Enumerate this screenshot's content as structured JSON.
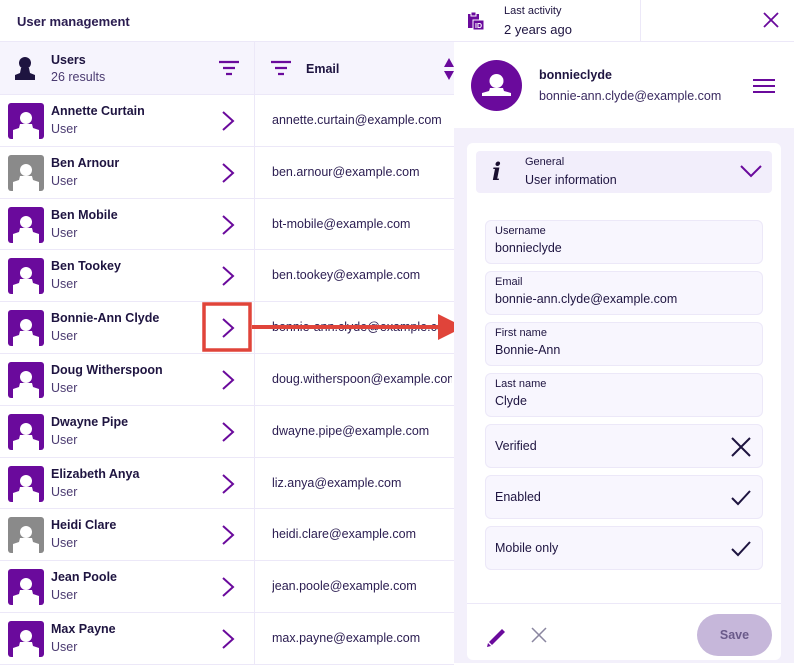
{
  "header": {
    "title": "User management",
    "last_activity_label": "Last activity",
    "last_activity_value": "2 years ago"
  },
  "list": {
    "title": "Users",
    "count": "26 results",
    "email_header": "Email",
    "rows": [
      {
        "name": "Annette Curtain",
        "role": "User",
        "email": "annette.curtain@example.com",
        "avatar": "purple"
      },
      {
        "name": "Ben Arnour",
        "role": "User",
        "email": "ben.arnour@example.com",
        "avatar": "gray"
      },
      {
        "name": "Ben Mobile",
        "role": "User",
        "email": "bt-mobile@example.com",
        "avatar": "purple"
      },
      {
        "name": "Ben Tookey",
        "role": "User",
        "email": "ben.tookey@example.com",
        "avatar": "purple"
      },
      {
        "name": "Bonnie-Ann Clyde",
        "role": "User",
        "email": "bonnie-ann.clyde@example.com",
        "avatar": "purple"
      },
      {
        "name": "Doug Witherspoon",
        "role": "User",
        "email": "doug.witherspoon@example.com",
        "avatar": "purple"
      },
      {
        "name": "Dwayne Pipe",
        "role": "User",
        "email": "dwayne.pipe@example.com",
        "avatar": "purple"
      },
      {
        "name": "Elizabeth Anya",
        "role": "User",
        "email": "liz.anya@example.com",
        "avatar": "purple"
      },
      {
        "name": "Heidi Clare",
        "role": "User",
        "email": "heidi.clare@example.com",
        "avatar": "gray"
      },
      {
        "name": "Jean Poole",
        "role": "User",
        "email": "jean.poole@example.com",
        "avatar": "purple"
      },
      {
        "name": "Max Payne",
        "role": "User",
        "email": "max.payne@example.com",
        "avatar": "purple"
      }
    ]
  },
  "detail": {
    "username": "bonnieclyde",
    "email": "bonnie-ann.clyde@example.com",
    "section": {
      "label": "General",
      "title": "User information"
    },
    "fields": [
      {
        "label": "Username",
        "value": "bonnieclyde"
      },
      {
        "label": "Email",
        "value": "bonnie-ann.clyde@example.com"
      },
      {
        "label": "First name",
        "value": "Bonnie-Ann"
      },
      {
        "label": "Last name",
        "value": "Clyde"
      }
    ],
    "toggles": [
      {
        "label": "Verified",
        "value": false
      },
      {
        "label": "Enabled",
        "value": true
      },
      {
        "label": "Mobile only",
        "value": true
      }
    ],
    "save_label": "Save"
  },
  "colors": {
    "accent": "#6a0a9c",
    "highlight": "#e0443a"
  }
}
